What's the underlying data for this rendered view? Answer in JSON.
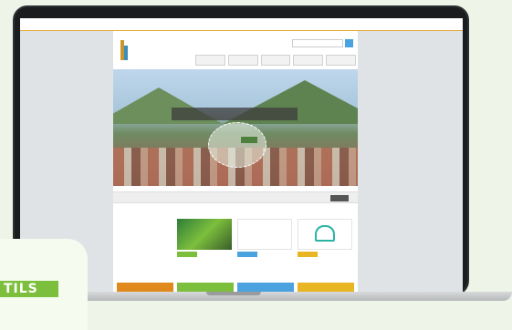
{
  "topbar": {
    "left_text": "",
    "right_text": ""
  },
  "header": {
    "logo_text": "",
    "search_placeholder": "",
    "icons": "",
    "nav": [
      "",
      "",
      "",
      "",
      ""
    ]
  },
  "hero": {
    "caption": "",
    "tag": ""
  },
  "ticker": {
    "text": "",
    "button": ""
  },
  "sidebar": {
    "title": "",
    "links": [
      "",
      "",
      "",
      ""
    ]
  },
  "news": {
    "title": "",
    "cards": [
      {
        "text": "",
        "button": ""
      },
      {
        "text": "",
        "button": ""
      },
      {
        "text": "",
        "button": ""
      }
    ]
  },
  "footer_buttons": [
    "",
    "",
    "",
    ""
  ],
  "badge": {
    "label": "TILS"
  },
  "colors": {
    "accent_orange": "#e08a1e",
    "accent_green": "#7cbf3c",
    "accent_blue": "#4aa3df",
    "background": "#eef4e8"
  }
}
